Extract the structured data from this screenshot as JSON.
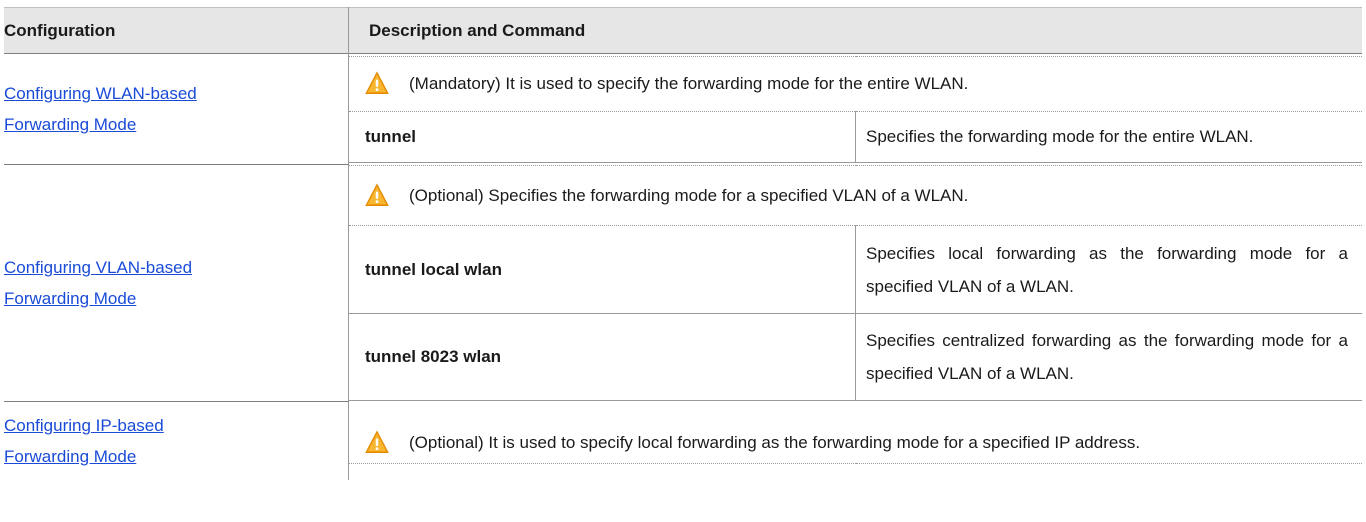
{
  "header": {
    "configuration": "Configuration",
    "description": "Description and Command"
  },
  "rows": [
    {
      "link_line1": "Configuring WLAN-based",
      "link_line2": "Forwarding Mode",
      "note": "(Mandatory) It is used to specify the forwarding mode for the entire WLAN.",
      "commands": [
        {
          "name": "tunnel",
          "desc": "Specifies the forwarding mode for the entire WLAN."
        }
      ]
    },
    {
      "link_line1": "Configuring VLAN-based",
      "link_line2": "Forwarding Mode",
      "note": "(Optional) Specifies the forwarding mode for a specified VLAN of a WLAN.",
      "commands": [
        {
          "name": "tunnel local wlan",
          "desc": "Specifies local forwarding as the forwarding mode for a specified VLAN of a WLAN."
        },
        {
          "name": "tunnel 8023 wlan",
          "desc": "Specifies centralized forwarding as the forwarding mode for a specified VLAN of a WLAN."
        }
      ]
    },
    {
      "link_line1": "Configuring IP-based",
      "link_line2": "Forwarding Mode",
      "note": "(Optional) It is used to specify local forwarding as the forwarding mode for a specified IP address.",
      "commands": []
    }
  ],
  "icon": {
    "name": "warning-icon",
    "color": "#f5a623"
  },
  "link_color": "#1a4bd8"
}
